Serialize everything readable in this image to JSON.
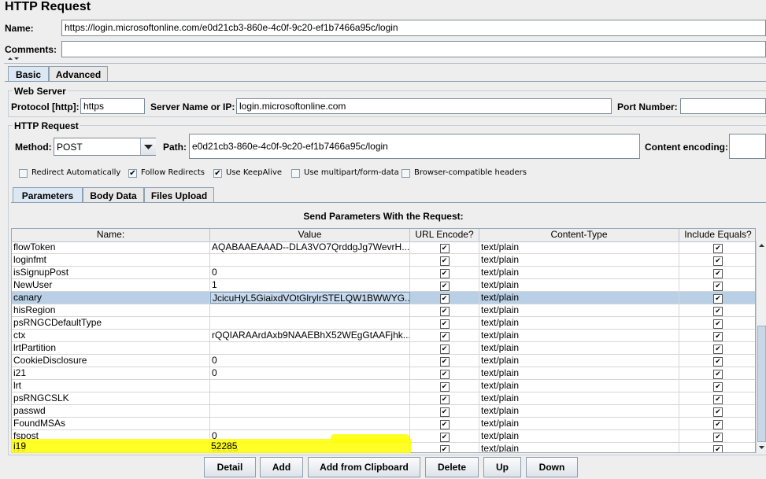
{
  "title": "HTTP Request",
  "name_label": "Name:",
  "name_value": "https://login.microsoftonline.com/e0d21cb3-860e-4c0f-9c20-ef1b7466a95c/login",
  "comments_label": "Comments:",
  "comments_value": "",
  "tabs": [
    {
      "label": "Basic"
    },
    {
      "label": "Advanced"
    }
  ],
  "web_server": {
    "title": "Web Server",
    "protocol_label": "Protocol [http]:",
    "protocol_value": "https",
    "server_label": "Server Name or IP:",
    "server_value": "login.microsoftonline.com",
    "port_label": "Port Number:",
    "port_value": ""
  },
  "http_request": {
    "title": "HTTP Request",
    "method_label": "Method:",
    "method_value": "POST",
    "path_label": "Path:",
    "path_value": "e0d21cb3-860e-4c0f-9c20-ef1b7466a95c/login",
    "encoding_label": "Content encoding:",
    "encoding_value": ""
  },
  "options": [
    {
      "label": "Redirect Automatically",
      "checked": false
    },
    {
      "label": "Follow Redirects",
      "checked": true
    },
    {
      "label": "Use KeepAlive",
      "checked": true
    },
    {
      "label": "Use multipart/form-data",
      "checked": false
    },
    {
      "label": "Browser-compatible headers",
      "checked": false
    }
  ],
  "subtabs": [
    {
      "label": "Parameters"
    },
    {
      "label": "Body Data"
    },
    {
      "label": "Files Upload"
    }
  ],
  "params_title": "Send Parameters With the Request:",
  "columns": [
    "Name:",
    "Value",
    "URL Encode?",
    "Content-Type",
    "Include Equals?"
  ],
  "check_mark": "✔",
  "rows": [
    {
      "name": "flowToken",
      "value": "AQABAAEAAAD--DLA3VO7QrddgJg7WevrH...",
      "type": "text/plain"
    },
    {
      "name": "loginfmt",
      "value": "",
      "type": "text/plain"
    },
    {
      "name": "isSignupPost",
      "value": "0",
      "type": "text/plain"
    },
    {
      "name": "NewUser",
      "value": "1",
      "type": "text/plain"
    },
    {
      "name": "canary",
      "value": "JcicuHyL5GiaixdVOtGlrylrSTELQW1BWWYG...",
      "type": "text/plain"
    },
    {
      "name": "hisRegion",
      "value": "",
      "type": "text/plain"
    },
    {
      "name": "psRNGCDefaultType",
      "value": "",
      "type": "text/plain"
    },
    {
      "name": "ctx",
      "value": "rQQIARAArdAxb9NAAEBhX52WEgGtAAFjhk...",
      "type": "text/plain"
    },
    {
      "name": "lrtPartition",
      "value": "",
      "type": "text/plain"
    },
    {
      "name": "CookieDisclosure",
      "value": "0",
      "type": "text/plain"
    },
    {
      "name": "i21",
      "value": "0",
      "type": "text/plain"
    },
    {
      "name": "lrt",
      "value": "",
      "type": "text/plain"
    },
    {
      "name": "psRNGCSLK",
      "value": "",
      "type": "text/plain"
    },
    {
      "name": "passwd",
      "value": "",
      "type": "text/plain"
    },
    {
      "name": "FoundMSAs",
      "value": "",
      "type": "text/plain"
    },
    {
      "name": "fspost",
      "value": "0",
      "type": "text/plain"
    },
    {
      "name": "i19",
      "value": "52285",
      "type": "text/plain"
    }
  ],
  "buttons": [
    {
      "label": "Detail"
    },
    {
      "label": "Add"
    },
    {
      "label": "Add from Clipboard"
    },
    {
      "label": "Delete"
    },
    {
      "label": "Up"
    },
    {
      "label": "Down"
    }
  ],
  "icons": {
    "dropdown": "chevron-down-icon",
    "scroll_up": "scroll-up-icon",
    "scroll_down": "scroll-down-icon",
    "collapse": "collapse-icon"
  }
}
